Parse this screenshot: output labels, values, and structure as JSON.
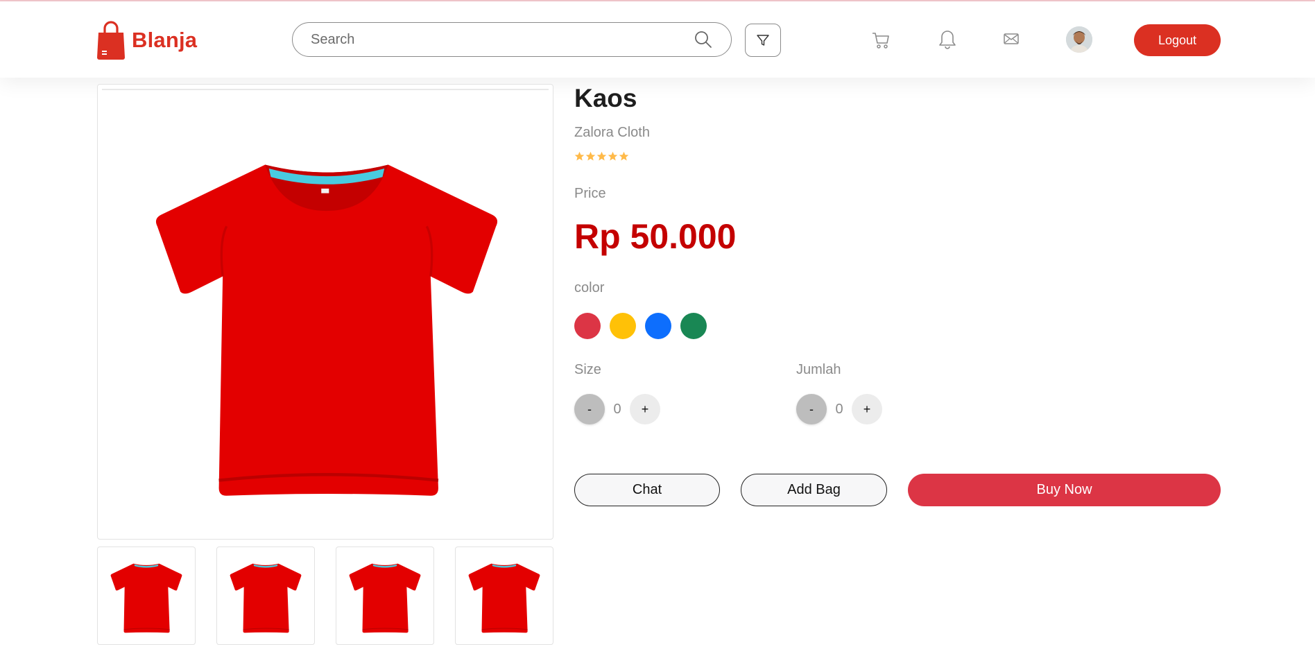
{
  "brand": {
    "name": "Blanja",
    "color": "#db3022"
  },
  "search": {
    "placeholder": "Search",
    "value": ""
  },
  "nav": {
    "icons": [
      "filter-icon",
      "cart-icon",
      "bell-icon",
      "mail-icon"
    ],
    "logout_label": "Logout"
  },
  "product": {
    "title": "Kaos",
    "brand": "Zalora Cloth",
    "rating": 5,
    "price_label": "Price",
    "price": "Rp 50.000",
    "image_subject": "red t-shirt",
    "thumbnail_count": 4
  },
  "options": {
    "color_label": "color",
    "colors": [
      "#dc3545",
      "#ffc107",
      "#0d6efd",
      "#198754"
    ],
    "size_label": "Size",
    "size_value": "0",
    "qty_label": "Jumlah",
    "qty_value": "0",
    "minus_label": "-",
    "plus_label": "+"
  },
  "actions": {
    "chat_label": "Chat",
    "add_bag_label": "Add Bag",
    "buy_label": "Buy Now",
    "buy_color": "#dc3545"
  }
}
